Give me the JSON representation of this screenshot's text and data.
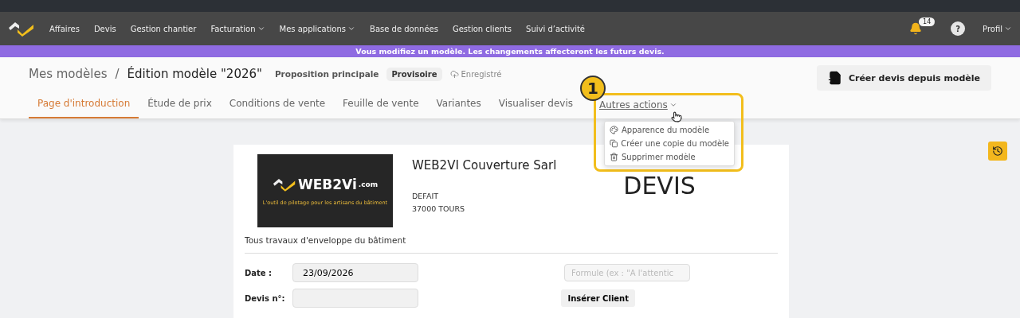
{
  "nav": {
    "items": [
      {
        "label": "Affaires",
        "dropdown": false
      },
      {
        "label": "Devis",
        "dropdown": false
      },
      {
        "label": "Gestion chantier",
        "dropdown": false
      },
      {
        "label": "Facturation",
        "dropdown": true
      },
      {
        "label": "Mes applications",
        "dropdown": true
      },
      {
        "label": "Base de données",
        "dropdown": false
      },
      {
        "label": "Gestion clients",
        "dropdown": false
      },
      {
        "label": "Suivi d’activité",
        "dropdown": false
      }
    ],
    "notifications": "14",
    "help": "?",
    "profile": "Profil"
  },
  "banner": "Vous modifiez un modèle. Les changements affecteront les futurs devis.",
  "header": {
    "breadcrumb": [
      "Mes modèles",
      "/",
      "Édition modèle \"2026\""
    ],
    "proposal": "Proposition principale",
    "status": "Provisoire",
    "saved": "Enregistré",
    "create_button": "Créer devis depuis modèle"
  },
  "tabs": [
    {
      "label": "Page d'introduction",
      "selected": true,
      "kind": "tab"
    },
    {
      "label": "Étude de prix",
      "selected": false,
      "kind": "tab"
    },
    {
      "label": "Conditions de vente",
      "selected": false,
      "kind": "tab"
    },
    {
      "label": "Feuille de vente",
      "selected": false,
      "kind": "tab"
    },
    {
      "label": "Variantes",
      "selected": false,
      "kind": "tab"
    },
    {
      "label": "Visualiser devis",
      "selected": false,
      "kind": "tab"
    },
    {
      "label": "Autres actions",
      "selected": false,
      "kind": "menu"
    }
  ],
  "annotation": "1",
  "menu": [
    {
      "label": "Apparence du modèle"
    },
    {
      "label": "Créer une copie du modèle"
    },
    {
      "label": "Supprimer modèle"
    }
  ],
  "document": {
    "logo": {
      "brand": "WEB2Vi",
      "suffix": ".com",
      "tagline": "L'outil de pilotage pour les artisans du bâtiment"
    },
    "company": "WEB2VI Couverture Sarl",
    "address": [
      "DEFAIT",
      "37000 TOURS"
    ],
    "title": "DEVIS",
    "activity": "Tous travaux d'enveloppe du bâtiment",
    "date_label": "Date :",
    "date_value": "23/09/2026",
    "number_label": "Devis n°:",
    "formula_placeholder": "Formule (ex : \"A l'attentic",
    "insert_client": "Insérer Client"
  }
}
